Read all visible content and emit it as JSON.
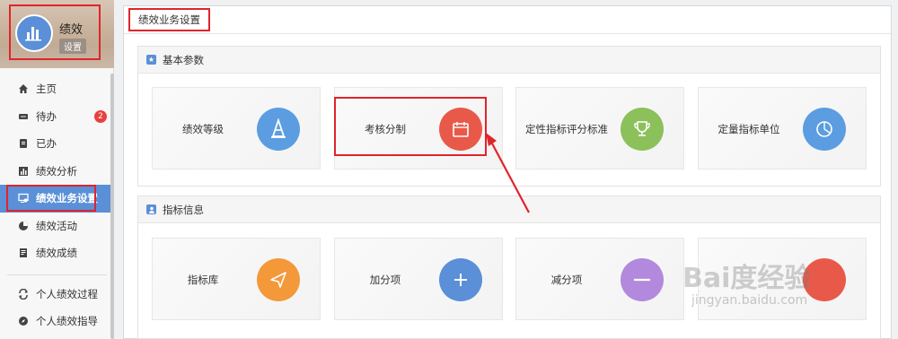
{
  "app": {
    "title": "绩效",
    "settings_badge": "设置"
  },
  "sidebar": {
    "items": [
      {
        "label": "主页",
        "icon": "home-icon"
      },
      {
        "label": "待办",
        "icon": "todo-icon",
        "badge": "2"
      },
      {
        "label": "已办",
        "icon": "done-icon"
      },
      {
        "label": "绩效分析",
        "icon": "bar-chart-icon"
      },
      {
        "label": "绩效业务设置",
        "icon": "settings-monitor-icon",
        "active": true
      },
      {
        "label": "绩效活动",
        "icon": "pie-icon"
      },
      {
        "label": "绩效成绩",
        "icon": "report-icon"
      }
    ],
    "items2": [
      {
        "label": "个人绩效过程",
        "icon": "refresh-icon"
      },
      {
        "label": "个人绩效指导",
        "icon": "compass-icon"
      }
    ]
  },
  "breadcrumb": "绩效业务设置",
  "sections": [
    {
      "title": "基本参数",
      "cards": [
        {
          "label": "绩效等级",
          "icon": "cone-icon",
          "color": "#5b9de0"
        },
        {
          "label": "考核分制",
          "icon": "calendar-icon",
          "color": "#e9594a"
        },
        {
          "label": "定性指标评分标准",
          "icon": "trophy-icon",
          "color": "#8cc05a"
        },
        {
          "label": "定量指标单位",
          "icon": "pie-clock-icon",
          "color": "#5b9de0"
        }
      ]
    },
    {
      "title": "指标信息",
      "cards": [
        {
          "label": "指标库",
          "icon": "paper-plane-icon",
          "color": "#f3993a"
        },
        {
          "label": "加分项",
          "icon": "plus-icon",
          "color": "#5b8fd7"
        },
        {
          "label": "减分项",
          "icon": "minus-icon",
          "color": "#b289dc"
        },
        {
          "label": "",
          "icon": "circle-icon",
          "color": "#e9594a"
        }
      ]
    }
  ],
  "watermark": {
    "brand": "Bai度经验",
    "url": "jingyan.baidu.com"
  },
  "colors": {
    "accent": "#5b8fd7",
    "highlight": "#e0242b"
  }
}
